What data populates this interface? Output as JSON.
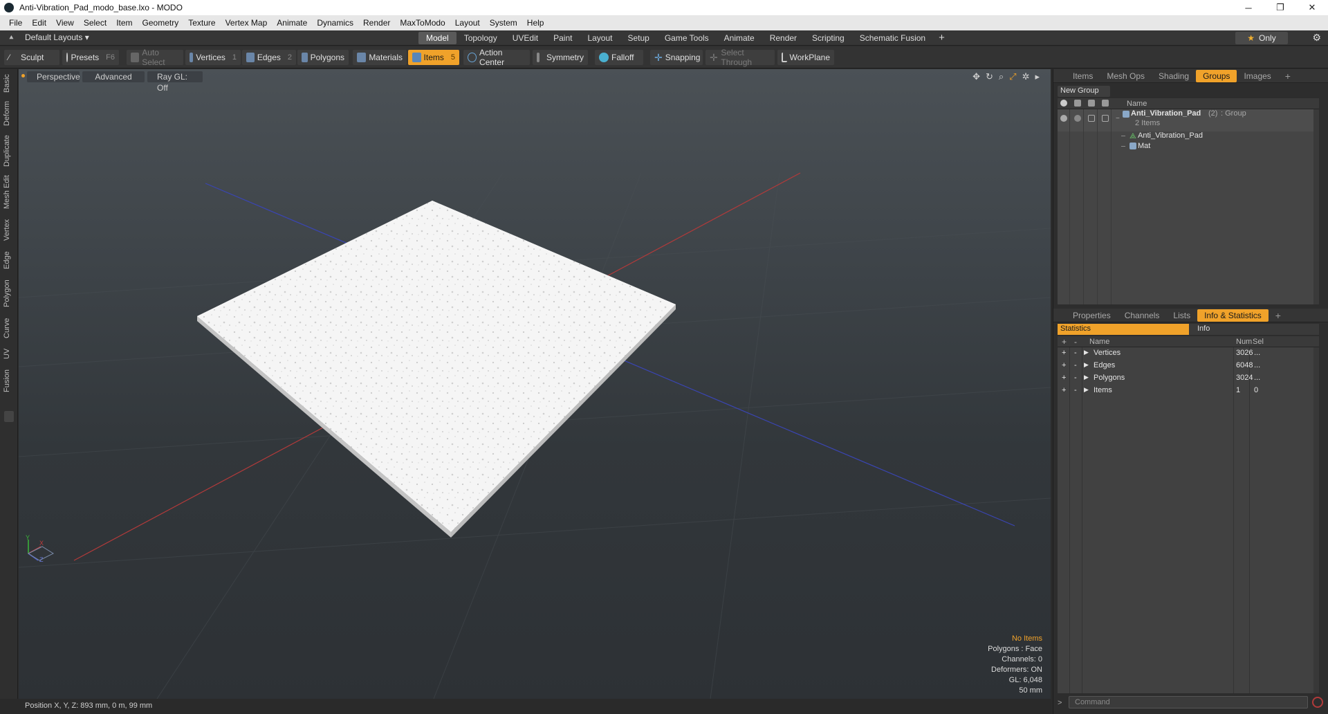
{
  "window": {
    "title": "Anti-Vibration_Pad_modo_base.lxo - MODO",
    "minimize": "─",
    "maximize": "❐",
    "close": "✕"
  },
  "menu": [
    "File",
    "Edit",
    "View",
    "Select",
    "Item",
    "Geometry",
    "Texture",
    "Vertex Map",
    "Animate",
    "Dynamics",
    "Render",
    "MaxToModo",
    "Layout",
    "System",
    "Help"
  ],
  "modebar": {
    "layouts": "Default Layouts ▾",
    "tabs": [
      "Model",
      "Topology",
      "UVEdit",
      "Paint",
      "Layout",
      "Setup",
      "Game Tools",
      "Animate",
      "Render",
      "Scripting",
      "Schematic Fusion"
    ],
    "active_tab": "Model",
    "plus": "+",
    "only_label": "Only",
    "only_icon": "★",
    "gear_icon": "⚙"
  },
  "toolbar": {
    "sculpt": "Sculpt",
    "presets": "Presets",
    "presets_key": "F6",
    "auto_select": "Auto Select",
    "vertices": "Vertices",
    "vertices_key": "1",
    "edges": "Edges",
    "edges_key": "2",
    "polygons": "Polygons",
    "materials": "Materials",
    "items": "Items",
    "items_key": "5",
    "action_center": "Action Center",
    "symmetry": "Symmetry",
    "falloff": "Falloff",
    "snapping": "Snapping",
    "select_through": "Select Through",
    "workplane": "WorkPlane"
  },
  "left_tabs": [
    "Basic",
    "Deform",
    "Duplicate",
    "Mesh Edit",
    "Vertex",
    "Edge",
    "Polygon",
    "Curve",
    "UV",
    "Fusion"
  ],
  "viewport": {
    "perspective": "Perspective",
    "advanced": "Advanced",
    "raygl": "Ray GL: Off",
    "icons": [
      "move-icon",
      "rotate-icon",
      "zoom-icon",
      "fit-icon",
      "settings-icon",
      "play-icon"
    ],
    "info": {
      "no_items": "No Items",
      "polygons": "Polygons : Face",
      "channels": "Channels: 0",
      "deformers": "Deformers: ON",
      "gl": "GL: 6,048",
      "scale": "50 mm"
    },
    "axes": {
      "x": "X",
      "y": "Y",
      "z": "Z"
    }
  },
  "status": {
    "position": "Position X, Y, Z:  893 mm, 0 m, 99 mm"
  },
  "groups_panel": {
    "tabs": [
      "Items",
      "Mesh Ops",
      "Shading",
      "Groups",
      "Images"
    ],
    "active_tab": "Groups",
    "plus": "+",
    "new_group": "New Group",
    "name_col": "Name",
    "group_name": "Anti_Vibration_Pad",
    "group_count": "(2)",
    "group_type": ": Group",
    "group_items": "2 Items",
    "children": [
      "Anti_Vibration_Pad",
      "Mat"
    ]
  },
  "stats_panel": {
    "tabs": [
      "Properties",
      "Channels",
      "Lists",
      "Info & Statistics"
    ],
    "active_tab": "Info & Statistics",
    "plus": "+",
    "sub_tabs": [
      "Statistics",
      "Info"
    ],
    "headers": {
      "name": "Name",
      "num": "Num",
      "sel": "Sel"
    },
    "rows": [
      {
        "name": "Vertices",
        "num": "3026",
        "sel": "..."
      },
      {
        "name": "Edges",
        "num": "6048",
        "sel": "..."
      },
      {
        "name": "Polygons",
        "num": "3024",
        "sel": "..."
      },
      {
        "name": "Items",
        "num": "1",
        "sel": "0"
      }
    ],
    "command_placeholder": "Command",
    "prompt": ">"
  },
  "colors": {
    "accent": "#f0a22a",
    "viewport_top": "#4b5156",
    "viewport_bottom": "#2d3135",
    "pad": "#f4f4f4",
    "axis_red": "#b23a3a",
    "axis_blue": "#3a45b2"
  }
}
